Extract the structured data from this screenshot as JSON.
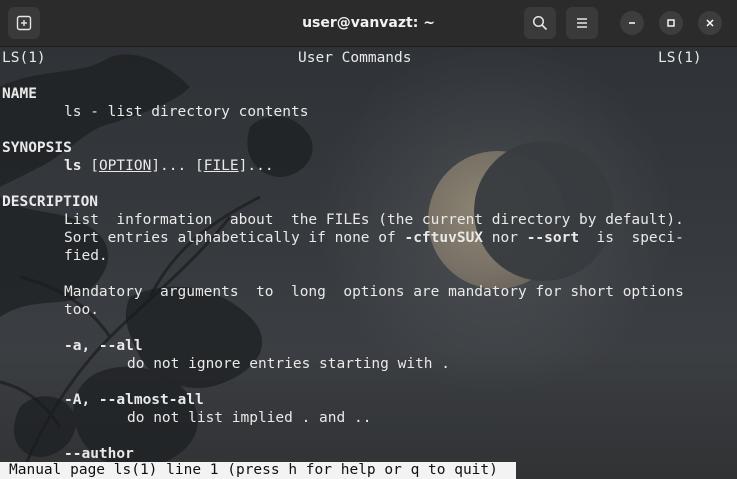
{
  "window": {
    "title": "user@vanvazt: ~",
    "icons": {
      "new_tab": "new-tab-icon",
      "search": "search-icon",
      "menu": "hamburger-menu-icon",
      "minimize": "minimize-icon",
      "maximize": "maximize-icon",
      "close": "close-icon"
    }
  },
  "man": {
    "header_left": "LS(1)",
    "header_center": "User Commands",
    "header_right": "LS(1)",
    "name_heading": "NAME",
    "name_text": "ls - list directory contents",
    "synopsis_heading": "SYNOPSIS",
    "synopsis_cmd": "ls",
    "synopsis_open1": "[",
    "synopsis_option": "OPTION",
    "synopsis_mid": "]... [",
    "synopsis_file": "FILE",
    "synopsis_end": "]...",
    "description_heading": "DESCRIPTION",
    "desc_line1": "List  information  about  the FILEs (the current directory by default).",
    "desc_line2_a": "Sort entries alphabetically if none of ",
    "desc_line2_flags": "-cftuvSUX",
    "desc_line2_b": " nor ",
    "desc_line2_sort": "--sort",
    "desc_line2_c": "  is  speci-",
    "desc_line3": "fied.",
    "mandatory_line1": "Mandatory  arguments  to  long  options are mandatory for short options",
    "mandatory_line2": "too.",
    "opt_a": "-a, --all",
    "opt_a_desc": "do not ignore entries starting with .",
    "opt_A": "-A, --almost-all",
    "opt_A_desc": "do not list implied . and ..",
    "opt_author": "--author"
  },
  "status_bar": "Manual page ls(1) line 1 (press h for help or q to quit)",
  "colors": {
    "titlebar": "#2b2b2b",
    "text": "#e9e9e9",
    "status_bg": "#f3f3f3"
  }
}
